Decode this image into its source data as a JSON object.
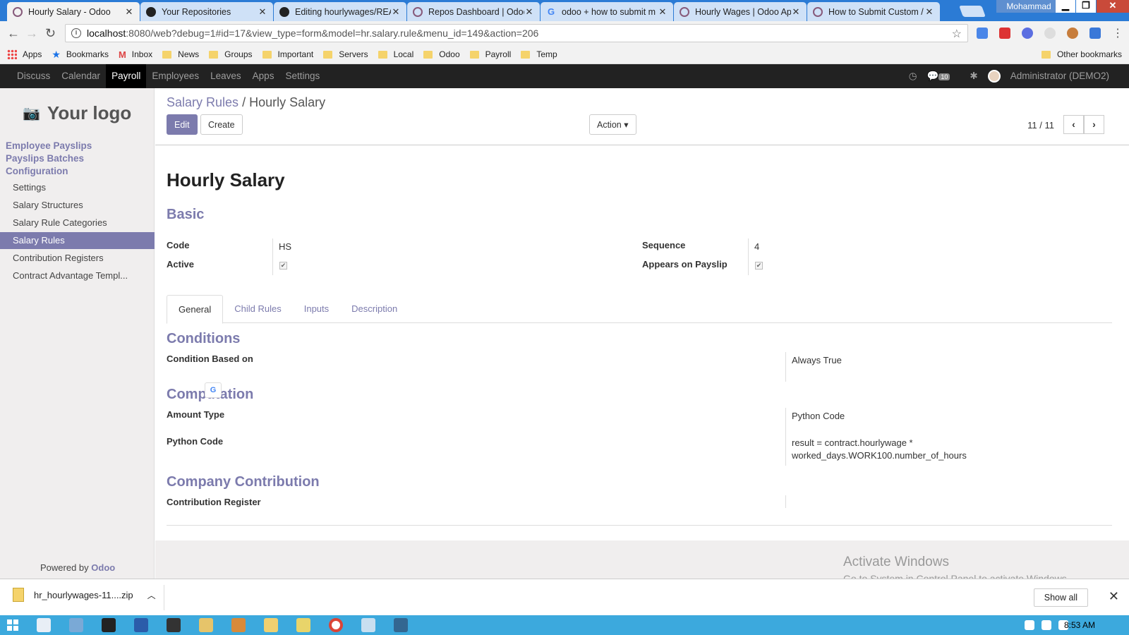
{
  "browser": {
    "tabs": [
      {
        "title": "Hourly Salary - Odoo",
        "icon": "odoo"
      },
      {
        "title": "Your Repositories",
        "icon": "github"
      },
      {
        "title": "Editing hourlywages/REA",
        "icon": "github"
      },
      {
        "title": "Repos Dashboard | Odoo",
        "icon": "odoo"
      },
      {
        "title": "odoo + how to submit m",
        "icon": "google"
      },
      {
        "title": "Hourly Wages | Odoo Ap",
        "icon": "odoo"
      },
      {
        "title": "How to Submit Custom /",
        "icon": "odoo"
      }
    ],
    "window_user": "Mohammad",
    "url_host": "localhost",
    "url_rest": ":8080/web?debug=1#id=17&view_type=form&model=hr.salary.rule&menu_id=149&action=206",
    "bookmarks": [
      "Apps",
      "Bookmarks",
      "Inbox",
      "News",
      "Groups",
      "Important",
      "Servers",
      "Local",
      "Odoo",
      "Payroll",
      "Temp"
    ],
    "other_bookmarks": "Other bookmarks"
  },
  "odoo_nav": {
    "items": [
      "Discuss",
      "Calendar",
      "Payroll",
      "Employees",
      "Leaves",
      "Apps",
      "Settings"
    ],
    "active": "Payroll",
    "message_count": "10",
    "user": "Administrator (DEMO2)"
  },
  "sidebar": {
    "logo": "Your logo",
    "headers": [
      "Employee Payslips",
      "Payslips Batches",
      "Configuration"
    ],
    "items": [
      "Settings",
      "Salary Structures",
      "Salary Rule Categories",
      "Salary Rules",
      "Contribution Registers",
      "Contract Advantage Templ..."
    ],
    "active_item": "Salary Rules",
    "powered_by": "Powered by",
    "powered_brand": "Odoo"
  },
  "control_panel": {
    "breadcrumb_parent": "Salary Rules",
    "breadcrumb_sep": "/",
    "breadcrumb_current": "Hourly Salary",
    "edit_label": "Edit",
    "create_label": "Create",
    "action_label": "Action ▾",
    "pager": "11 / 11"
  },
  "form": {
    "title": "Hourly Salary",
    "basic_section": "Basic",
    "code_label": "Code",
    "code_value": "HS",
    "active_label": "Active",
    "active_checked": true,
    "sequence_label": "Sequence",
    "sequence_value": "4",
    "appears_label": "Appears on Payslip",
    "appears_checked": true,
    "tabs": [
      "General",
      "Child Rules",
      "Inputs",
      "Description"
    ],
    "active_tab": "General",
    "conditions_section": "Conditions",
    "condition_label": "Condition Based on",
    "condition_value": "Always True",
    "computation_section": "Computation",
    "amount_type_label": "Amount Type",
    "amount_type_value": "Python Code",
    "python_code_label": "Python Code",
    "python_code_line1": "result = contract.hourlywage *",
    "python_code_line2": "worked_days.WORK100.number_of_hours",
    "company_section": "Company Contribution",
    "register_label": "Contribution Register",
    "register_value": ""
  },
  "watermark": {
    "line1": "Activate Windows",
    "line2": "Go to System in Control Panel to activate Windows."
  },
  "download_shelf": {
    "file": "hr_hourlywages-11....zip",
    "show_all": "Show all"
  },
  "taskbar": {
    "time": "8:53 AM"
  },
  "colors": {
    "odoo_accent": "#7c7bad",
    "odoo_nav_bg": "#222222",
    "taskbar": "#3ca9dd",
    "chrome_tabstrip": "#2b7bd5"
  }
}
